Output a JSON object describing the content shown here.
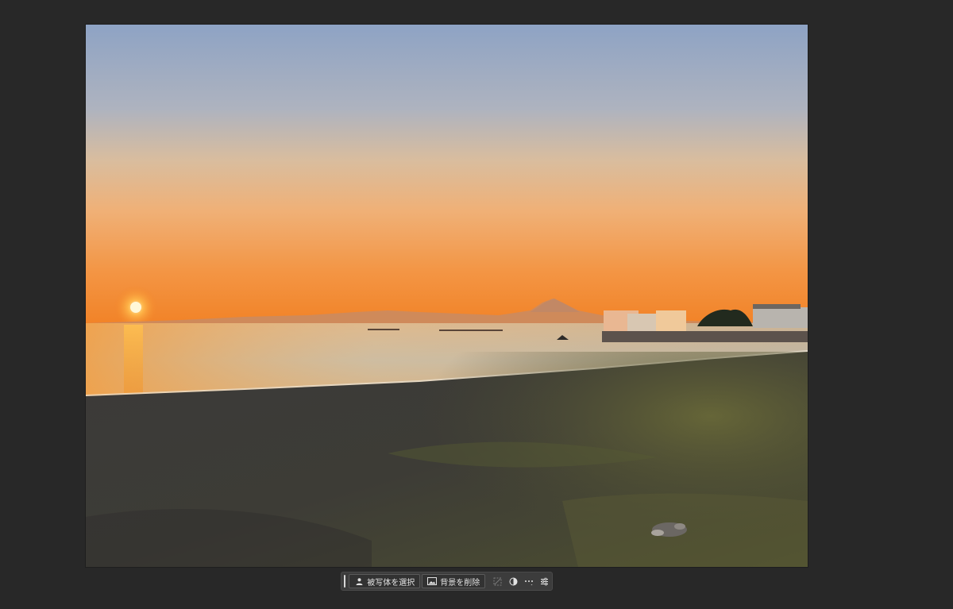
{
  "contextual_taskbar": {
    "select_subject_label": "被写体を選択",
    "remove_background_label": "背景を削除",
    "icons": {
      "select_subject": "person-subject-icon",
      "remove_background": "image-icon",
      "transform": "transform-icon",
      "adjustment": "half-circle-icon",
      "more": "more-options-icon",
      "settings": "sliders-icon"
    }
  },
  "colors": {
    "workspace_bg": "#282828",
    "taskbar_bg": "#3c3c3c",
    "sky_top": "#8ea3c4",
    "sky_horizon": "#f28a2c",
    "sand": "#3a3938",
    "grass": "#5a5a34"
  }
}
